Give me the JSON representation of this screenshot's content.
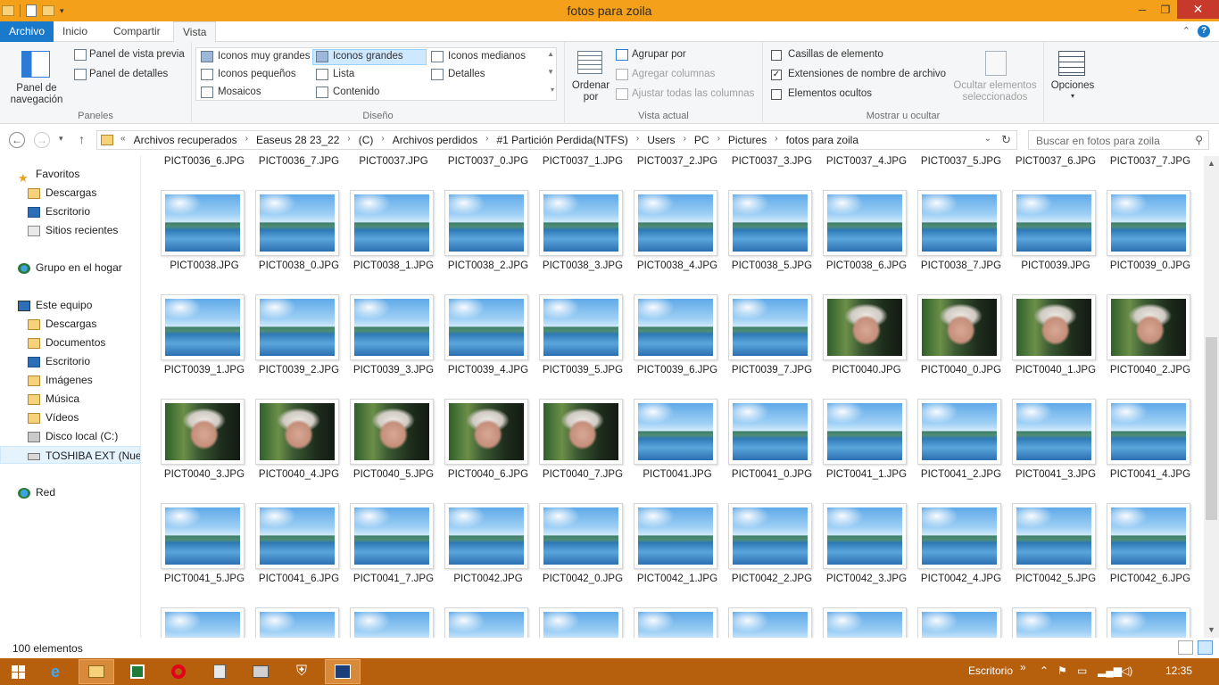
{
  "window": {
    "title": "fotos para zoila"
  },
  "ribbon_tabs": [
    "Archivo",
    "Inicio",
    "Compartir",
    "Vista"
  ],
  "ribbon": {
    "paneles": {
      "label": "Paneles",
      "nav_pane": "Panel de navegación",
      "preview": "Panel de vista previa",
      "details": "Panel de detalles"
    },
    "diseno": {
      "label": "Diseño",
      "options": [
        "Iconos muy grandes",
        "Iconos grandes",
        "Iconos medianos",
        "Iconos pequeños",
        "Lista",
        "Detalles",
        "Mosaicos",
        "Contenido"
      ],
      "selected": "Iconos grandes"
    },
    "vista_actual": {
      "label": "Vista actual",
      "sort": "Ordenar por",
      "group": "Agrupar por",
      "add_columns": "Agregar columnas",
      "fit_columns": "Ajustar todas las columnas"
    },
    "mostrar": {
      "label": "Mostrar u ocultar",
      "checkboxes": [
        {
          "label": "Casillas de elemento",
          "checked": false
        },
        {
          "label": "Extensiones de nombre de archivo",
          "checked": true
        },
        {
          "label": "Elementos ocultos",
          "checked": false
        }
      ],
      "hide_selected": "Ocultar elementos seleccionados"
    },
    "opciones": "Opciones"
  },
  "address": {
    "breadcrumbs": [
      "Archivos recuperados",
      "Easeus 28 23_22",
      "(C)",
      "Archivos perdidos",
      "#1 Partición Perdida(NTFS)",
      "Users",
      "PC",
      "Pictures",
      "fotos para zoila"
    ],
    "search_placeholder": "Buscar en fotos para zoila"
  },
  "nav_pane": {
    "favorites": {
      "label": "Favoritos",
      "items": [
        "Descargas",
        "Escritorio",
        "Sitios recientes"
      ]
    },
    "homegroup": "Grupo en el hogar",
    "computer": {
      "label": "Este equipo",
      "items": [
        "Descargas",
        "Documentos",
        "Escritorio",
        "Imágenes",
        "Música",
        "Vídeos",
        "Disco local (C:)",
        "TOSHIBA EXT (Nuev"
      ]
    },
    "network": "Red"
  },
  "files": [
    "PICT0036_6.JPG",
    "PICT0036_7.JPG",
    "PICT0037.JPG",
    "PICT0037_0.JPG",
    "PICT0037_1.JPG",
    "PICT0037_2.JPG",
    "PICT0037_3.JPG",
    "PICT0037_4.JPG",
    "PICT0037_5.JPG",
    "PICT0037_6.JPG",
    "PICT0037_7.JPG",
    "PICT0038.JPG",
    "PICT0038_0.JPG",
    "PICT0038_1.JPG",
    "PICT0038_2.JPG",
    "PICT0038_3.JPG",
    "PICT0038_4.JPG",
    "PICT0038_5.JPG",
    "PICT0038_6.JPG",
    "PICT0038_7.JPG",
    "PICT0039.JPG",
    "PICT0039_0.JPG",
    "PICT0039_1.JPG",
    "PICT0039_2.JPG",
    "PICT0039_3.JPG",
    "PICT0039_4.JPG",
    "PICT0039_5.JPG",
    "PICT0039_6.JPG",
    "PICT0039_7.JPG",
    "PICT0040.JPG",
    "PICT0040_0.JPG",
    "PICT0040_1.JPG",
    "PICT0040_2.JPG",
    "PICT0040_3.JPG",
    "PICT0040_4.JPG",
    "PICT0040_5.JPG",
    "PICT0040_6.JPG",
    "PICT0040_7.JPG",
    "PICT0041.JPG",
    "PICT0041_0.JPG",
    "PICT0041_1.JPG",
    "PICT0041_2.JPG",
    "PICT0041_3.JPG",
    "PICT0041_4.JPG",
    "PICT0041_5.JPG",
    "PICT0041_6.JPG",
    "PICT0041_7.JPG",
    "PICT0042.JPG",
    "PICT0042_0.JPG",
    "PICT0042_1.JPG",
    "PICT0042_2.JPG",
    "PICT0042_3.JPG",
    "PICT0042_4.JPG",
    "PICT0042_5.JPG",
    "PICT0042_6.JPG"
  ],
  "status": {
    "count": "100 elementos"
  },
  "taskbar": {
    "desktop_label": "Escritorio",
    "clock": "12:35"
  },
  "colors": {
    "titlebar": "#f5a01a",
    "file_tab": "#1979ca",
    "taskbar": "#b65f0c",
    "selection": "#cde8ff"
  }
}
